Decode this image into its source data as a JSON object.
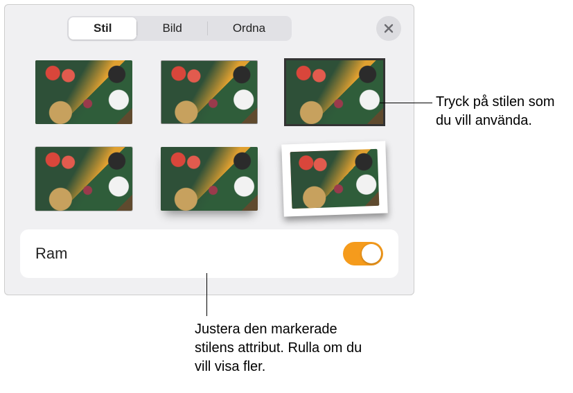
{
  "tabs": {
    "items": [
      {
        "label": "Stil",
        "active": true
      },
      {
        "label": "Bild",
        "active": false
      },
      {
        "label": "Ordna",
        "active": false
      }
    ]
  },
  "close_icon": "close",
  "styles": [
    {
      "name": "style-none"
    },
    {
      "name": "style-thin-border"
    },
    {
      "name": "style-thick-border"
    },
    {
      "name": "style-hairline"
    },
    {
      "name": "style-shadow"
    },
    {
      "name": "style-photo-frame"
    }
  ],
  "section": {
    "label": "Ram",
    "toggle_on": true
  },
  "callouts": {
    "c1": "Tryck på stilen som du vill använda.",
    "c2": "Justera den markerade stilens attribut. Rulla om du vill visa fler."
  }
}
